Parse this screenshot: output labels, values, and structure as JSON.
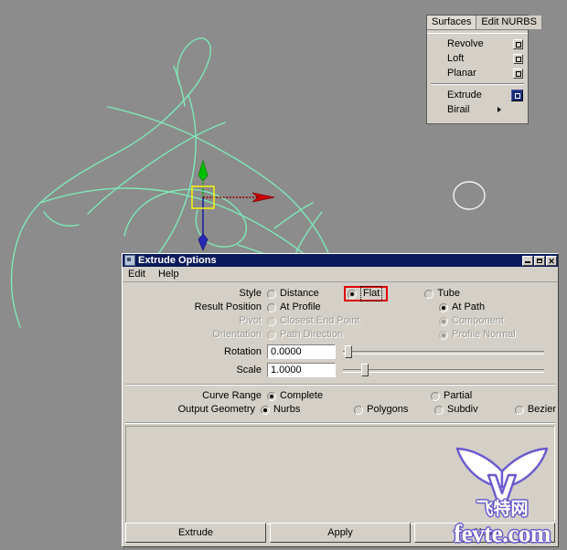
{
  "viewport": {
    "name": "maya-perspective-viewport",
    "background_color": "#8c8c8c",
    "curve_color": "#7fe8b8",
    "profile_circle_color": "#ffffff",
    "manipulator": {
      "y_axis_color": "#00c000",
      "x_axis_color": "#c00000",
      "z_axis_color": "#2020a0",
      "center_handle_color": "#ffff00"
    }
  },
  "menu_panel": {
    "tabs": [
      {
        "label": "Surfaces",
        "active": true
      },
      {
        "label": "Edit NURBS",
        "active": false
      }
    ],
    "items": [
      {
        "label": "Revolve",
        "option_box": true,
        "selected": false,
        "submenu": false
      },
      {
        "label": "Loft",
        "option_box": true,
        "selected": false,
        "submenu": false
      },
      {
        "label": "Planar",
        "option_box": true,
        "selected": false,
        "submenu": false
      },
      {
        "label": "Extrude",
        "option_box": true,
        "selected": true,
        "submenu": false
      },
      {
        "label": "Birail",
        "option_box": false,
        "selected": false,
        "submenu": true
      }
    ]
  },
  "dialog": {
    "title": "Extrude Options",
    "titlebar_color": "#0a1a5a",
    "window_buttons": {
      "minimize": "minimize-button",
      "maximize": "maximize-button",
      "close": "✕"
    },
    "menubar": [
      {
        "label": "Edit"
      },
      {
        "label": "Help"
      }
    ],
    "options": {
      "style": {
        "label": "Style",
        "choices": [
          {
            "label": "Distance",
            "selected": false,
            "disabled": false
          },
          {
            "label": "Flat",
            "selected": true,
            "disabled": false,
            "highlighted": true,
            "focused": true
          },
          {
            "label": "Tube",
            "selected": false,
            "disabled": false
          }
        ]
      },
      "result_position": {
        "label": "Result Position",
        "choices": [
          {
            "label": "At Profile",
            "selected": false,
            "disabled": false
          },
          {
            "label": "At Path",
            "selected": true,
            "disabled": false
          }
        ]
      },
      "pivot": {
        "label": "Pivot",
        "disabled": true,
        "choices": [
          {
            "label": "Closest End Point",
            "selected": false,
            "disabled": true
          },
          {
            "label": "Component",
            "selected": true,
            "disabled": true
          }
        ]
      },
      "orientation": {
        "label": "Orientation",
        "disabled": true,
        "choices": [
          {
            "label": "Path Direction",
            "selected": false,
            "disabled": true
          },
          {
            "label": "Profile Normal",
            "selected": true,
            "disabled": true
          }
        ]
      },
      "rotation": {
        "label": "Rotation",
        "value": "0.0000",
        "slider_percent": 1
      },
      "scale": {
        "label": "Scale",
        "value": "1.0000",
        "slider_percent": 9
      },
      "curve_range": {
        "label": "Curve Range",
        "choices": [
          {
            "label": "Complete",
            "selected": true,
            "disabled": false
          },
          {
            "label": "Partial",
            "selected": false,
            "disabled": false
          }
        ]
      },
      "output_geometry": {
        "label": "Output Geometry",
        "choices": [
          {
            "label": "Nurbs",
            "selected": true,
            "disabled": false
          },
          {
            "label": "Polygons",
            "selected": false,
            "disabled": false
          },
          {
            "label": "Subdiv",
            "selected": false,
            "disabled": false
          },
          {
            "label": "Bezier",
            "selected": false,
            "disabled": false
          }
        ]
      }
    },
    "buttons": [
      {
        "label": "Extrude"
      },
      {
        "label": "Apply"
      },
      {
        "label": "Close"
      }
    ]
  },
  "watermark": {
    "chinese": "飞特网",
    "domain": "fevte.com",
    "color": "#6a5acd"
  }
}
